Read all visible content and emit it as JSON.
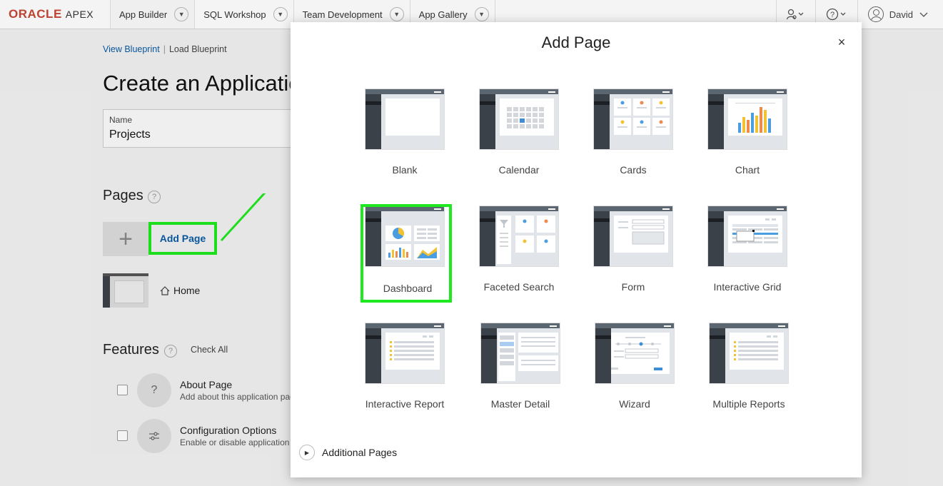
{
  "nav": {
    "brand_oracle": "ORACLE",
    "brand_apex": "APEX",
    "tabs": [
      "App Builder",
      "SQL Workshop",
      "Team Development",
      "App Gallery"
    ],
    "user": "David"
  },
  "page": {
    "view_blueprint": "View Blueprint",
    "load_blueprint": "Load Blueprint",
    "title": "Create an Application",
    "name_label": "Name",
    "name_value": "Projects",
    "pages_heading": "Pages",
    "add_page_link": "Add Page",
    "home_page": "Home",
    "features_heading": "Features",
    "check_all": "Check All",
    "features": [
      {
        "title": "About Page",
        "desc": "Add about this application page"
      },
      {
        "title": "Configuration Options",
        "desc": "Enable or disable application features"
      }
    ]
  },
  "dialog": {
    "title": "Add Page",
    "close": "×",
    "tiles": [
      "Blank",
      "Calendar",
      "Cards",
      "Chart",
      "Dashboard",
      "Faceted Search",
      "Form",
      "Interactive Grid",
      "Interactive Report",
      "Master Detail",
      "Wizard",
      "Multiple Reports"
    ],
    "selected_tile": "Dashboard",
    "additional_pages": "Additional Pages"
  },
  "colors": {
    "highlight": "#1ee81e",
    "link": "#0a5aa5",
    "oracle_red": "#c74634"
  }
}
